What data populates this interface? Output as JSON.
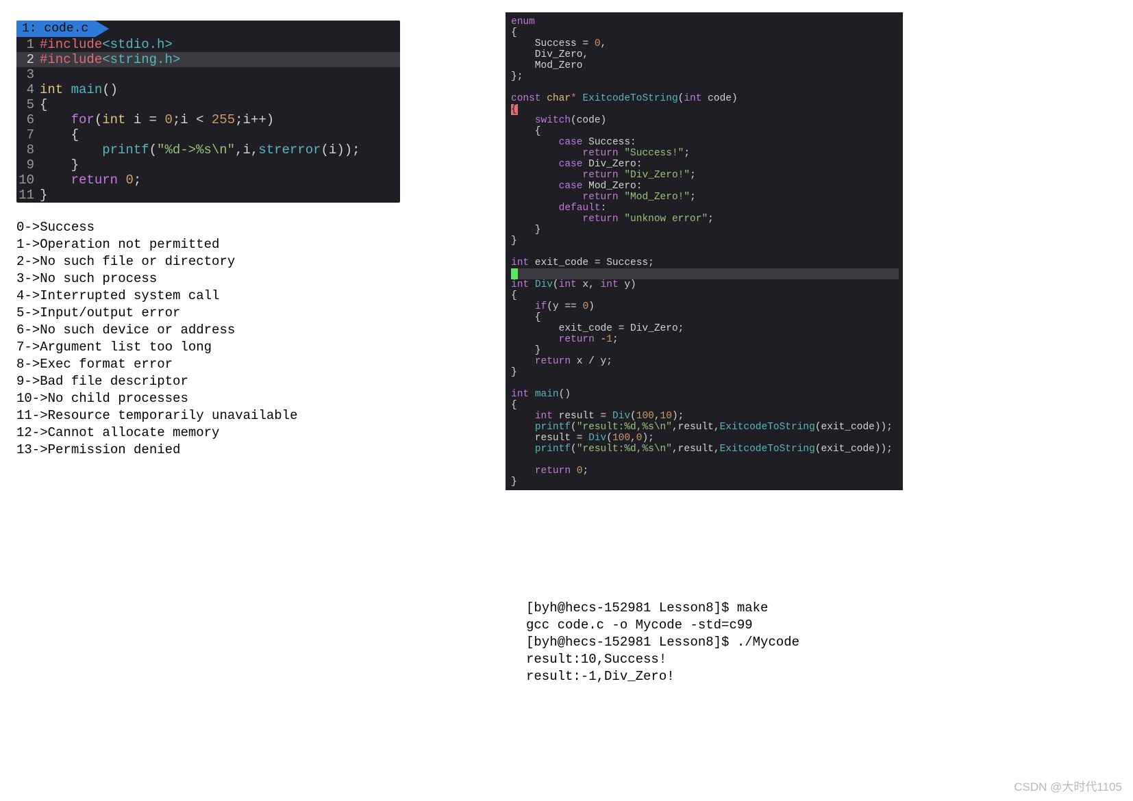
{
  "left": {
    "tab_label": "1: code.c",
    "code": [
      {
        "n": "1",
        "hl": false,
        "tokens": [
          [
            "c-pre",
            "#include"
          ],
          [
            "c-inc",
            "<stdio.h>"
          ]
        ]
      },
      {
        "n": "2",
        "hl": true,
        "tokens": [
          [
            "c-pre",
            "#"
          ],
          [
            "c-pre",
            "include"
          ],
          [
            "c-inc",
            "<string.h>"
          ]
        ]
      },
      {
        "n": "3",
        "hl": false,
        "tokens": []
      },
      {
        "n": "4",
        "hl": false,
        "tokens": [
          [
            "c-type",
            "int "
          ],
          [
            "c-fn",
            "main"
          ],
          [
            "c-pl",
            "()"
          ]
        ]
      },
      {
        "n": "5",
        "hl": false,
        "tokens": [
          [
            "c-pl",
            "{"
          ]
        ]
      },
      {
        "n": "6",
        "hl": false,
        "tokens": [
          [
            "c-pl",
            "    "
          ],
          [
            "c-kw",
            "for"
          ],
          [
            "c-pl",
            "("
          ],
          [
            "c-type",
            "int"
          ],
          [
            "c-pl",
            " i = "
          ],
          [
            "c-num",
            "0"
          ],
          [
            "c-pl",
            ";i < "
          ],
          [
            "c-num",
            "255"
          ],
          [
            "c-pl",
            ";i++)"
          ]
        ]
      },
      {
        "n": "7",
        "hl": false,
        "tokens": [
          [
            "c-pl",
            "    {"
          ]
        ]
      },
      {
        "n": "8",
        "hl": false,
        "tokens": [
          [
            "c-pl",
            "        "
          ],
          [
            "c-fn",
            "printf"
          ],
          [
            "c-pl",
            "("
          ],
          [
            "c-str",
            "\"%d->%s\\n\""
          ],
          [
            "c-pl",
            ",i,"
          ],
          [
            "c-fn",
            "strerror"
          ],
          [
            "c-pl",
            "(i));"
          ]
        ]
      },
      {
        "n": "9",
        "hl": false,
        "tokens": [
          [
            "c-pl",
            "    }"
          ]
        ]
      },
      {
        "n": "10",
        "hl": false,
        "tokens": [
          [
            "c-pl",
            "    "
          ],
          [
            "c-kw",
            "return"
          ],
          [
            "c-pl",
            " "
          ],
          [
            "c-num",
            "0"
          ],
          [
            "c-pl",
            ";"
          ]
        ]
      },
      {
        "n": "11",
        "hl": false,
        "tokens": [
          [
            "c-pl",
            "}"
          ]
        ]
      }
    ],
    "output": [
      "0->Success",
      "1->Operation not permitted",
      "2->No such file or directory",
      "3->No such process",
      "4->Interrupted system call",
      "5->Input/output error",
      "6->No such device or address",
      "7->Argument list too long",
      "8->Exec format error",
      "9->Bad file descriptor",
      "10->No child processes",
      "11->Resource temporarily unavailable",
      "12->Cannot allocate memory",
      "13->Permission denied"
    ]
  },
  "right": {
    "code": [
      {
        "cls": "",
        "tokens": [
          [
            "t-kw",
            "enum"
          ]
        ]
      },
      {
        "cls": "",
        "tokens": [
          [
            "t-pl",
            "{"
          ]
        ]
      },
      {
        "cls": "",
        "tokens": [
          [
            "t-pl",
            "    Success = "
          ],
          [
            "t-num",
            "0"
          ],
          [
            "t-pl",
            ","
          ]
        ]
      },
      {
        "cls": "",
        "tokens": [
          [
            "t-pl",
            "    Div_Zero,"
          ]
        ]
      },
      {
        "cls": "",
        "tokens": [
          [
            "t-pl",
            "    Mod_Zero"
          ]
        ]
      },
      {
        "cls": "",
        "tokens": [
          [
            "t-pl",
            "};"
          ]
        ]
      },
      {
        "cls": "",
        "tokens": []
      },
      {
        "cls": "",
        "tokens": [
          [
            "t-kw",
            "const "
          ],
          [
            "t-ident",
            "char"
          ],
          [
            "t-star",
            "* "
          ],
          [
            "t-fn",
            "ExitcodeToString"
          ],
          [
            "t-pl",
            "("
          ],
          [
            "t-kw",
            "int"
          ],
          [
            "t-pl",
            " code)"
          ]
        ]
      },
      {
        "cls": "",
        "tokens": [
          [
            "red-brace",
            "{"
          ]
        ]
      },
      {
        "cls": "",
        "tokens": [
          [
            "t-pl",
            "    "
          ],
          [
            "t-kw",
            "switch"
          ],
          [
            "t-pl",
            "(code)"
          ]
        ]
      },
      {
        "cls": "",
        "tokens": [
          [
            "t-pl",
            "    {"
          ]
        ]
      },
      {
        "cls": "",
        "tokens": [
          [
            "t-pl",
            "        "
          ],
          [
            "t-kw",
            "case"
          ],
          [
            "t-pl",
            " Success:"
          ]
        ]
      },
      {
        "cls": "",
        "tokens": [
          [
            "t-pl",
            "            "
          ],
          [
            "t-kw",
            "return"
          ],
          [
            "t-pl",
            " "
          ],
          [
            "t-str",
            "\"Success!\""
          ],
          [
            "t-pl",
            ";"
          ]
        ]
      },
      {
        "cls": "",
        "tokens": [
          [
            "t-pl",
            "        "
          ],
          [
            "t-kw",
            "case"
          ],
          [
            "t-pl",
            " Div_Zero:"
          ]
        ]
      },
      {
        "cls": "",
        "tokens": [
          [
            "t-pl",
            "            "
          ],
          [
            "t-kw",
            "return"
          ],
          [
            "t-pl",
            " "
          ],
          [
            "t-str",
            "\"Div_Zero!\""
          ],
          [
            "t-pl",
            ";"
          ]
        ]
      },
      {
        "cls": "",
        "tokens": [
          [
            "t-pl",
            "        "
          ],
          [
            "t-kw",
            "case"
          ],
          [
            "t-pl",
            " Mod_Zero:"
          ]
        ]
      },
      {
        "cls": "",
        "tokens": [
          [
            "t-pl",
            "            "
          ],
          [
            "t-kw",
            "return"
          ],
          [
            "t-pl",
            " "
          ],
          [
            "t-str",
            "\"Mod_Zero!\""
          ],
          [
            "t-pl",
            ";"
          ]
        ]
      },
      {
        "cls": "",
        "tokens": [
          [
            "t-pl",
            "        "
          ],
          [
            "t-kw",
            "default"
          ],
          [
            "t-pl",
            ":"
          ]
        ]
      },
      {
        "cls": "",
        "tokens": [
          [
            "t-pl",
            "            "
          ],
          [
            "t-kw",
            "return"
          ],
          [
            "t-pl",
            " "
          ],
          [
            "t-str",
            "\"unknow error\""
          ],
          [
            "t-pl",
            ";"
          ]
        ]
      },
      {
        "cls": "",
        "tokens": [
          [
            "t-pl",
            "    }"
          ]
        ]
      },
      {
        "cls": "",
        "tokens": [
          [
            "t-pl",
            "}"
          ]
        ]
      },
      {
        "cls": "",
        "tokens": []
      },
      {
        "cls": "",
        "tokens": [
          [
            "t-kw",
            "int"
          ],
          [
            "t-pl",
            " exit_code = Success;"
          ]
        ]
      },
      {
        "cls": "hl-line",
        "tokens": [
          [
            "green-cursor",
            " "
          ]
        ]
      },
      {
        "cls": "",
        "tokens": [
          [
            "t-kw",
            "int"
          ],
          [
            "t-pl",
            " "
          ],
          [
            "t-fn",
            "Div"
          ],
          [
            "t-pl",
            "("
          ],
          [
            "t-kw",
            "int"
          ],
          [
            "t-pl",
            " x, "
          ],
          [
            "t-kw",
            "int"
          ],
          [
            "t-pl",
            " y)"
          ]
        ]
      },
      {
        "cls": "",
        "tokens": [
          [
            "t-pl",
            "{"
          ]
        ]
      },
      {
        "cls": "",
        "tokens": [
          [
            "t-pl",
            "    "
          ],
          [
            "t-kw",
            "if"
          ],
          [
            "t-pl",
            "(y == "
          ],
          [
            "t-num",
            "0"
          ],
          [
            "t-pl",
            ")"
          ]
        ]
      },
      {
        "cls": "",
        "tokens": [
          [
            "t-pl",
            "    {"
          ]
        ]
      },
      {
        "cls": "",
        "tokens": [
          [
            "t-pl",
            "        exit_code = Div_Zero;"
          ]
        ]
      },
      {
        "cls": "",
        "tokens": [
          [
            "t-pl",
            "        "
          ],
          [
            "t-kw",
            "return"
          ],
          [
            "t-pl",
            " -"
          ],
          [
            "t-num",
            "1"
          ],
          [
            "t-pl",
            ";"
          ]
        ]
      },
      {
        "cls": "",
        "tokens": [
          [
            "t-pl",
            "    }"
          ]
        ]
      },
      {
        "cls": "",
        "tokens": [
          [
            "t-pl",
            "    "
          ],
          [
            "t-kw",
            "return"
          ],
          [
            "t-pl",
            " x / y;"
          ]
        ]
      },
      {
        "cls": "",
        "tokens": [
          [
            "t-pl",
            "}"
          ]
        ]
      },
      {
        "cls": "",
        "tokens": []
      },
      {
        "cls": "",
        "tokens": [
          [
            "t-kw",
            "int"
          ],
          [
            "t-pl",
            " "
          ],
          [
            "t-fn",
            "main"
          ],
          [
            "t-pl",
            "()"
          ]
        ]
      },
      {
        "cls": "",
        "tokens": [
          [
            "t-pl",
            "{"
          ]
        ]
      },
      {
        "cls": "",
        "tokens": [
          [
            "t-pl",
            "    "
          ],
          [
            "t-kw",
            "int"
          ],
          [
            "t-pl",
            " result = "
          ],
          [
            "t-fn",
            "Div"
          ],
          [
            "t-pl",
            "("
          ],
          [
            "t-num",
            "100"
          ],
          [
            "t-pl",
            ","
          ],
          [
            "t-num",
            "10"
          ],
          [
            "t-pl",
            ");"
          ]
        ]
      },
      {
        "cls": "",
        "tokens": [
          [
            "t-pl",
            "    "
          ],
          [
            "t-fn",
            "printf"
          ],
          [
            "t-pl",
            "("
          ],
          [
            "t-str",
            "\"result:%d,%s\\n\""
          ],
          [
            "t-pl",
            ",result,"
          ],
          [
            "t-fn",
            "ExitcodeToString"
          ],
          [
            "t-pl",
            "(exit_code));"
          ]
        ]
      },
      {
        "cls": "",
        "tokens": [
          [
            "t-pl",
            "    result = "
          ],
          [
            "t-fn",
            "Div"
          ],
          [
            "t-pl",
            "("
          ],
          [
            "t-num",
            "100"
          ],
          [
            "t-pl",
            ","
          ],
          [
            "t-num",
            "0"
          ],
          [
            "t-pl",
            ");"
          ]
        ]
      },
      {
        "cls": "",
        "tokens": [
          [
            "t-pl",
            "    "
          ],
          [
            "t-fn",
            "printf"
          ],
          [
            "t-pl",
            "("
          ],
          [
            "t-str",
            "\"result:%d,%s\\n\""
          ],
          [
            "t-pl",
            ",result,"
          ],
          [
            "t-fn",
            "ExitcodeToString"
          ],
          [
            "t-pl",
            "(exit_code));"
          ]
        ]
      },
      {
        "cls": "",
        "tokens": []
      },
      {
        "cls": "",
        "tokens": [
          [
            "t-pl",
            "    "
          ],
          [
            "t-kw",
            "return"
          ],
          [
            "t-pl",
            " "
          ],
          [
            "t-num",
            "0"
          ],
          [
            "t-pl",
            ";"
          ]
        ]
      },
      {
        "cls": "",
        "tokens": [
          [
            "t-pl",
            "}"
          ]
        ]
      }
    ],
    "output": [
      "[byh@hecs-152981 Lesson8]$ make",
      "gcc code.c -o Mycode -std=c99",
      "[byh@hecs-152981 Lesson8]$ ./Mycode",
      "result:10,Success!",
      "result:-1,Div_Zero!"
    ]
  },
  "watermark": "CSDN @大时代1105"
}
